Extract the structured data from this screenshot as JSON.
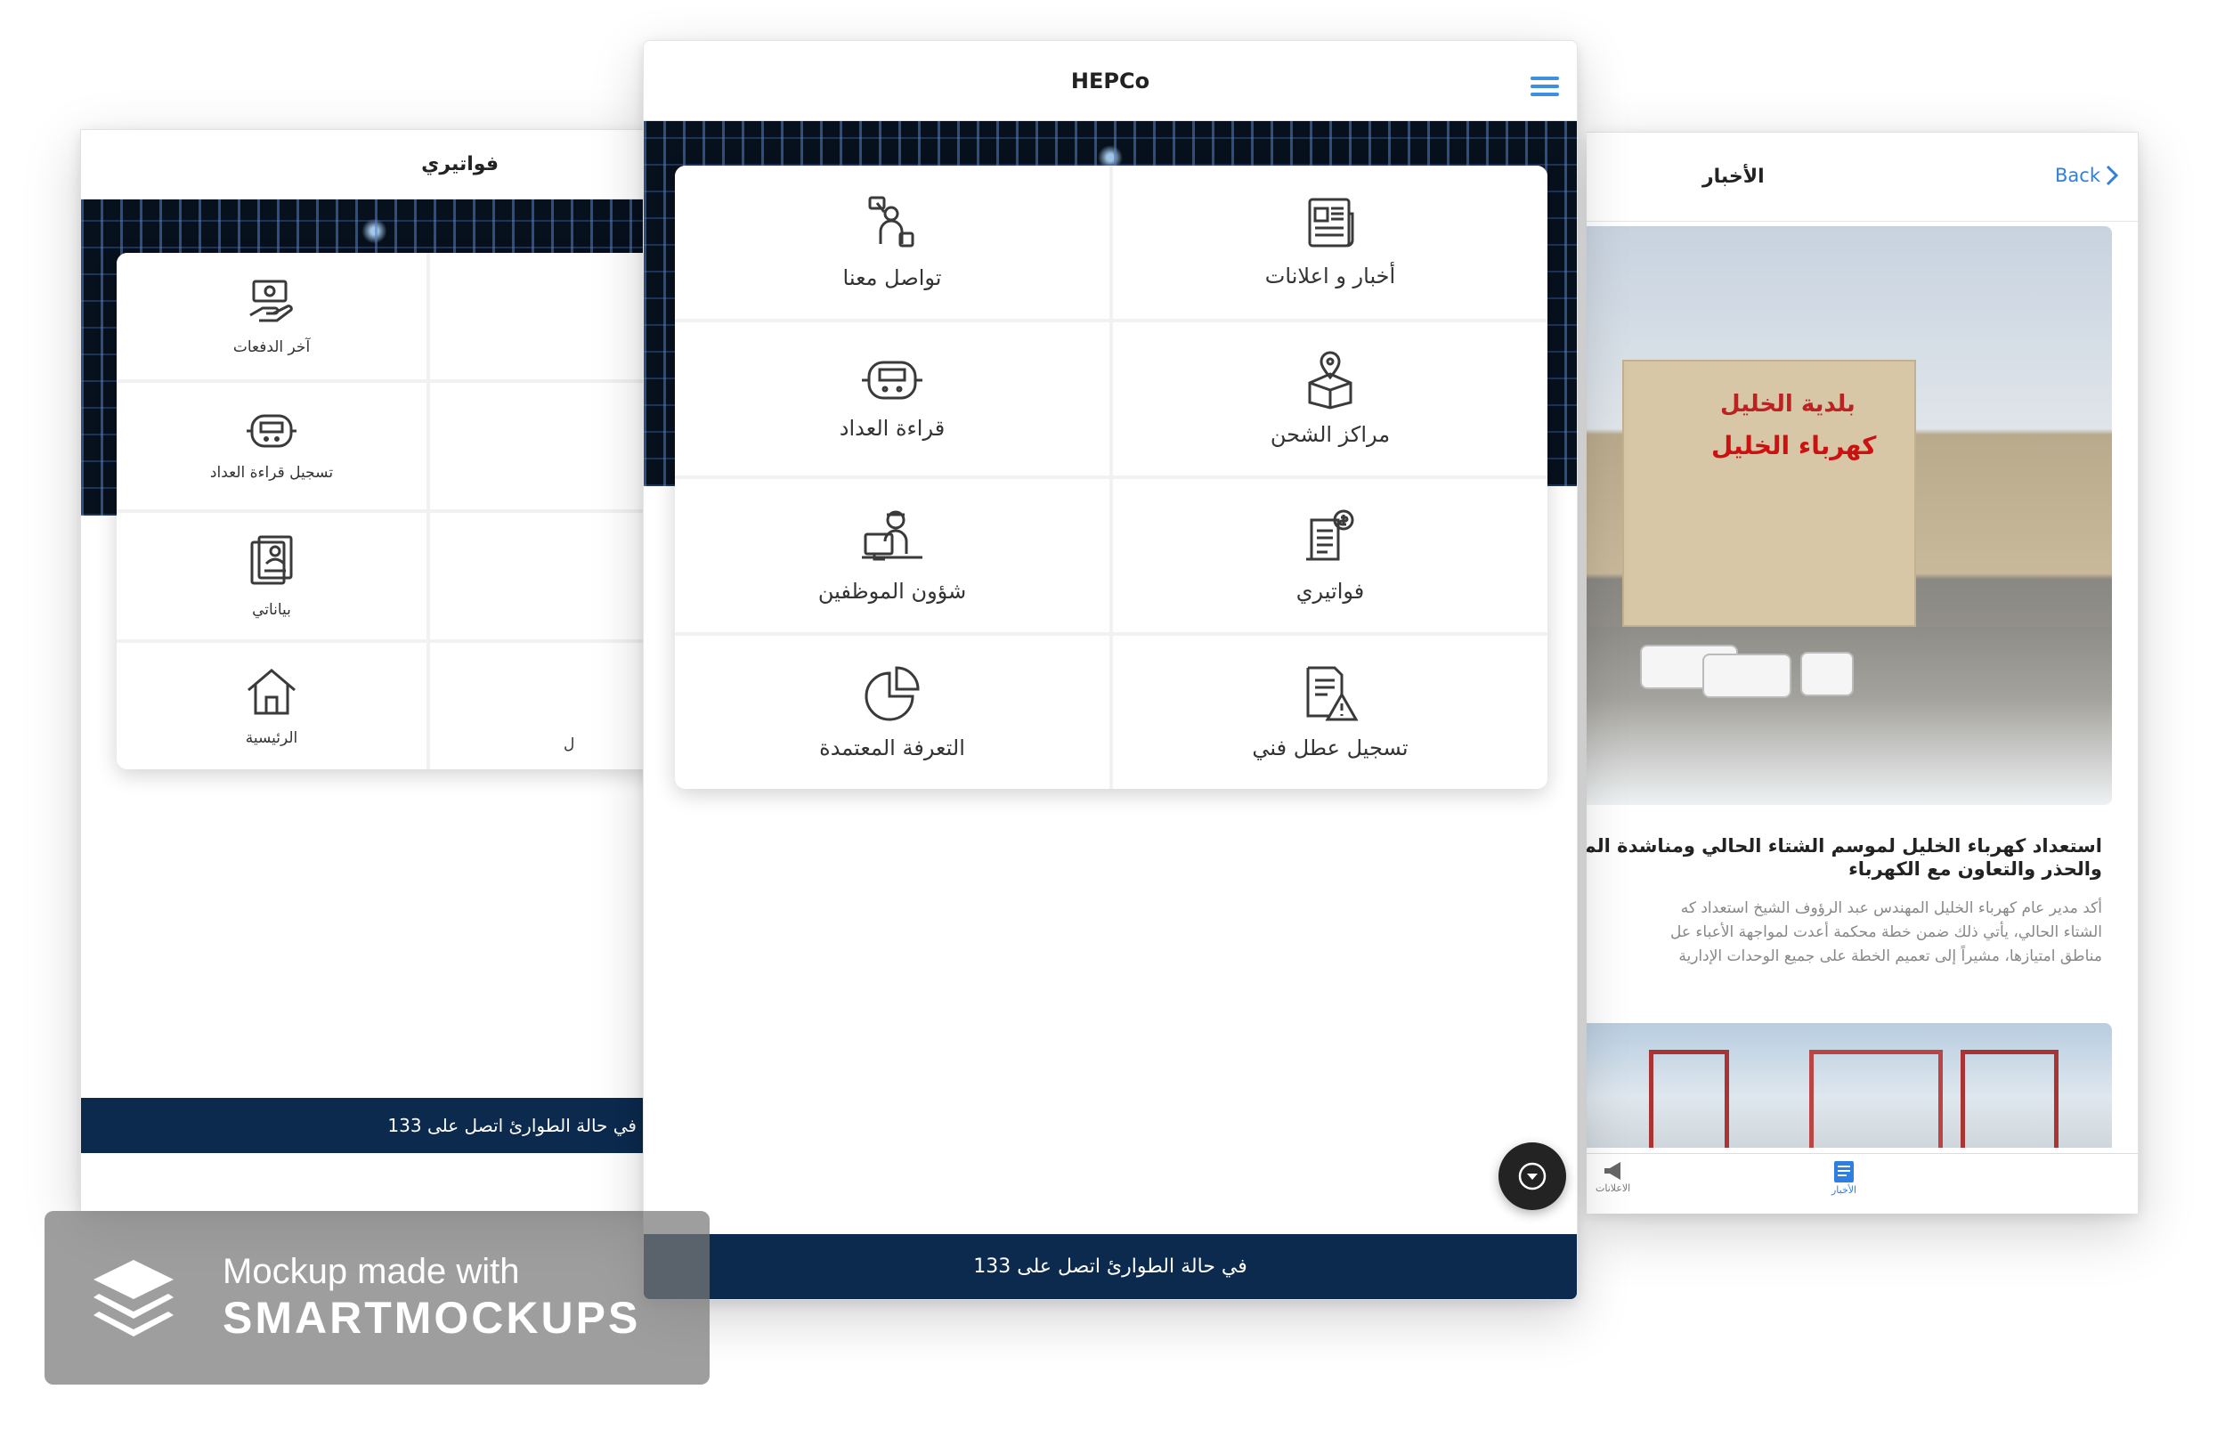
{
  "center": {
    "title": "HEPCo",
    "tiles": [
      {
        "label": "تواصل معنا",
        "icon": "contact-icon"
      },
      {
        "label": "أخبار و اعلانات",
        "icon": "news-icon"
      },
      {
        "label": "قراءة العداد",
        "icon": "meter-icon"
      },
      {
        "label": "مراكز الشحن",
        "icon": "charging-location-icon"
      },
      {
        "label": "شؤون الموظفين",
        "icon": "employee-icon"
      },
      {
        "label": "فواتيري",
        "icon": "invoice-icon"
      },
      {
        "label": "التعرفة المعتمدة",
        "icon": "pie-chart-icon"
      },
      {
        "label": "تسجيل عطل فني",
        "icon": "report-fault-icon"
      }
    ],
    "footer": "في حالة الطوارئ اتصل على 133"
  },
  "left": {
    "title": "فواتيري",
    "tiles": [
      {
        "label": "آخر الدفعات",
        "icon": "payment-icon"
      },
      {
        "label": "",
        "icon": ""
      },
      {
        "label": "تسجيل قراءة العداد",
        "icon": "meter-icon"
      },
      {
        "label": "",
        "icon": ""
      },
      {
        "label": "بياناتي",
        "icon": "profile-data-icon"
      },
      {
        "label": "",
        "icon": ""
      },
      {
        "label": "الرئيسية",
        "icon": "home-icon"
      },
      {
        "label": "ل",
        "icon": ""
      }
    ],
    "footer": "في حالة الطوارئ اتصل على 133"
  },
  "right": {
    "title": "الأخبار",
    "back": "Back",
    "photo_sign_line1": "بلدية الخليل",
    "photo_sign_line2": "كهرباء الخليل",
    "headline_line1": "استعداد كهرباء الخليل لموسم الشتاء الحالي ومناشدة المواط",
    "headline_line2": "والحذر والتعاون مع الكهرباء",
    "excerpt_line1": "أكد مدير عام كهرباء الخليل المهندس عبد الرؤوف الشيخ استعداد كه",
    "excerpt_line2": "الشتاء الحالي، يأتي ذلك ضمن خطة محكمة أعدت لمواجهة الأعباء عل",
    "excerpt_line3": "مناطق امتيازها، مشيراً إلى تعميم الخطة على جميع الوحدات الإدارية",
    "tab1": "الاعلانات",
    "tab2": "الأخبار"
  },
  "watermark": {
    "line1": "Mockup made with",
    "line2": "SMARTMOCKUPS"
  },
  "colors": {
    "navy": "#0b2a4e",
    "link_blue": "#2f7fe0",
    "menu_blue": "#3d8fe0"
  }
}
